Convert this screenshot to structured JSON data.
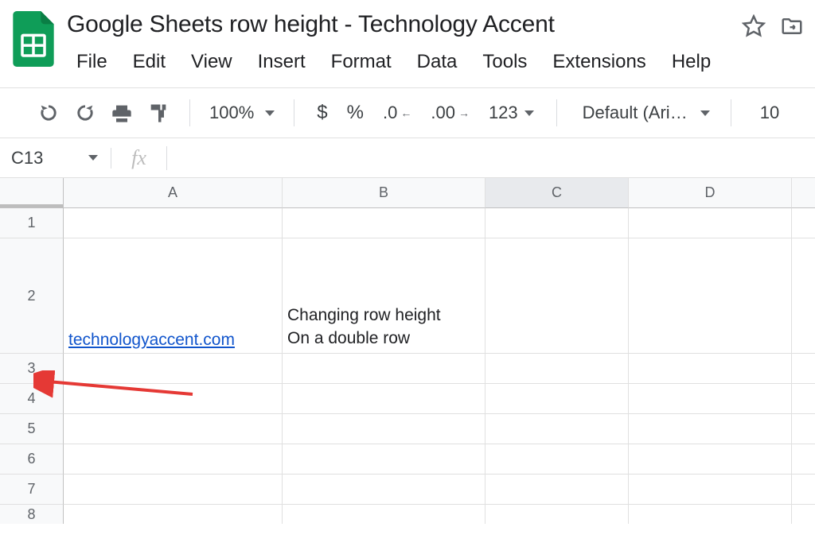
{
  "doc_title": "Google Sheets row height - Technology Accent",
  "menubar": {
    "file": "File",
    "edit": "Edit",
    "view": "View",
    "insert": "Insert",
    "format": "Format",
    "data": "Data",
    "tools": "Tools",
    "extensions": "Extensions",
    "help": "Help"
  },
  "toolbar": {
    "zoom": "100%",
    "currency": "$",
    "percent": "%",
    "dec_decrease": ".0",
    "dec_increase": ".00",
    "more_fmt": "123",
    "font": "Default (Ari…",
    "font_size": "10"
  },
  "name_box": "C13",
  "fx_label": "fx",
  "columns": {
    "A": "A",
    "B": "B",
    "C": "C",
    "D": "D"
  },
  "rows": {
    "r1": "1",
    "r2": "2",
    "r3": "3",
    "r4": "4",
    "r5": "5",
    "r6": "6",
    "r7": "7",
    "r8": "8"
  },
  "cells": {
    "A2": "technologyaccent.com",
    "B2": "Changing row height\nOn a double row"
  }
}
